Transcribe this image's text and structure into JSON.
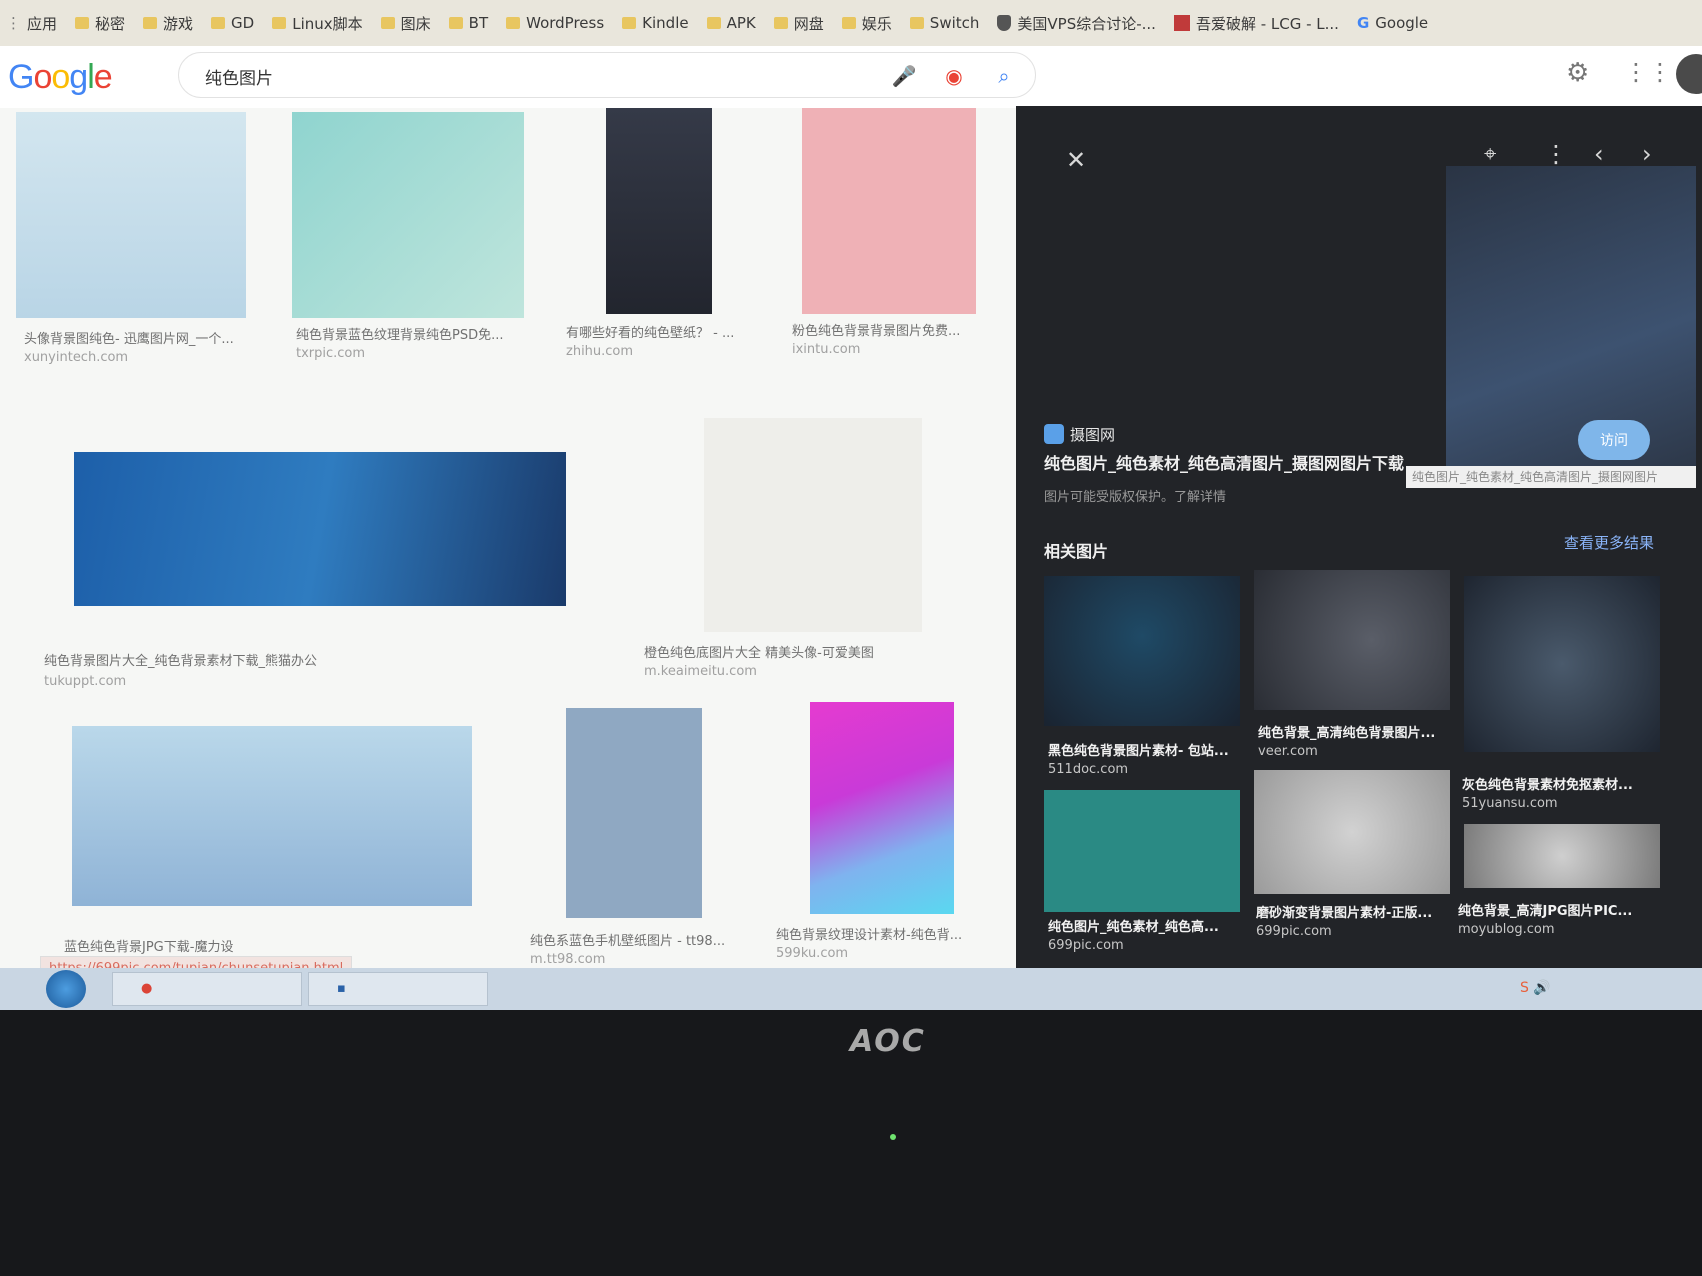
{
  "bookmarks": [
    "应用",
    "秘密",
    "游戏",
    "GD",
    "Linux脚本",
    "图床",
    "BT",
    "WordPress",
    "Kindle",
    "APK",
    "网盘",
    "娱乐",
    "Switch",
    "美国VPS综合讨论-...",
    "吾爱破解 - LCG - L...",
    "Google"
  ],
  "search": {
    "query": "纯色图片"
  },
  "results": [
    {
      "caption": "头像背景图纯色- 迅鹰图片网_一个...",
      "source": "xunyintech.com",
      "color": "#c7dde9"
    },
    {
      "caption": "纯色背景蓝色纹理背景纯色PSD免...",
      "source": "txrpic.com",
      "color": "#9fd6d2"
    },
    {
      "caption": "有哪些好看的纯色壁纸？ - ...",
      "source": "zhihu.com",
      "color": "#2c3140"
    },
    {
      "caption": "粉色纯色背景背景图片免费...",
      "source": "ixintu.com",
      "color": "#efb1b6"
    },
    {
      "caption": "纯色背景图片大全_纯色背景素材下载_熊猫办公",
      "source": "tukuppt.com",
      "color": "#1f5fa6"
    },
    {
      "caption": "橙色纯色底图片大全 精美头像-可爱美图",
      "source": "m.keaimeitu.com",
      "color": "#eeeeea"
    },
    {
      "caption": "蓝色纯色背景JPG下载-魔力设",
      "source": "",
      "color": "#a8c7e0"
    },
    {
      "caption": "纯色系蓝色手机壁纸图片 - tt98...",
      "source": "m.tt98.com",
      "color": "#8fa8c2"
    },
    {
      "caption": "纯色背景纹理设计素材-纯色背...",
      "source": "599ku.com",
      "color": "#d13ad8"
    }
  ],
  "status_url": "https://699pic.com/tupian/chunsetupian.html",
  "panel": {
    "site_name": "摄图网",
    "title": "纯色图片_纯色素材_纯色高清图片_摄图网图片下载",
    "copyright_note": "图片可能受版权保护。了解详情",
    "visit_label": "访问",
    "tooltip": "纯色图片_纯色素材_纯色高清图片_摄图网图片",
    "related_heading": "相关图片",
    "more_results": "查看更多结果",
    "related": [
      {
        "caption": "黑色纯色背景图片素材- 包站...",
        "source": "511doc.com",
        "color": "#1f3a52"
      },
      {
        "caption": "纯色背景_高清纯色背景图片...",
        "source": "veer.com",
        "color": "#3a3e48"
      },
      {
        "caption": "灰色纯色背景素材免抠素材...",
        "source": "51yuansu.com",
        "color": "#2e3a48"
      },
      {
        "caption": "纯色图片_纯色素材_纯色高...",
        "source": "699pic.com",
        "color": "#2a8a84"
      },
      {
        "caption": "磨砂渐变背景图片素材-正版...",
        "source": "699pic.com",
        "color": "#bcbcbc"
      },
      {
        "caption": "纯色背景_高清JPG图片PIC...",
        "source": "moyublog.com",
        "color": "#9a9a9a"
      }
    ]
  },
  "monitor_brand": "AOC",
  "colors": {
    "accent": "#4285f4",
    "panel_bg": "#222428",
    "visit_button": "#7fb6ea"
  }
}
